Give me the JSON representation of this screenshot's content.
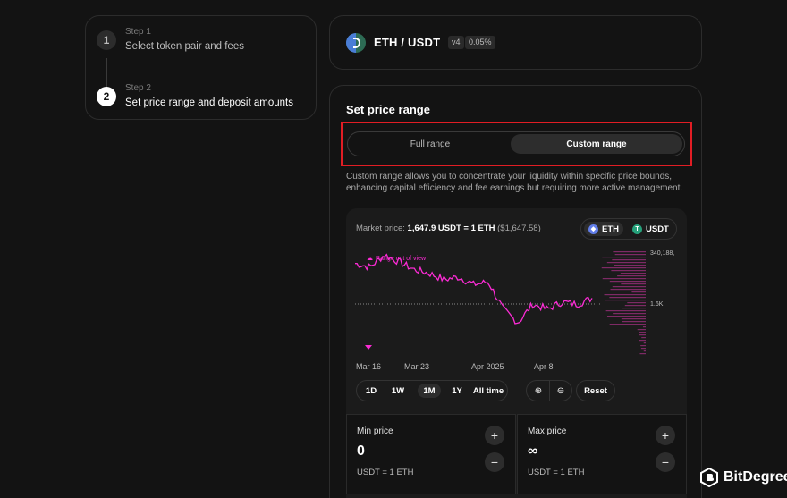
{
  "steps": [
    {
      "label": "Step 1",
      "title": "Select token pair and fees",
      "number": "1"
    },
    {
      "label": "Step 2",
      "title": "Set price range and deposit amounts",
      "number": "2"
    }
  ],
  "pair": {
    "title": "ETH / USDT",
    "version": "v4",
    "fee": "0.05%"
  },
  "range": {
    "title": "Set price range",
    "full_range": "Full range",
    "custom_range": "Custom range",
    "description": "Custom range allows you to concentrate your liquidity within specific price bounds, enhancing capital efficiency and fee earnings but requiring more active management."
  },
  "chart": {
    "market_label": "Market price:",
    "market_value": "1,647.9 USDT = 1 ETH",
    "market_usd": "($1,647.58)",
    "token_a": "ETH",
    "token_b": "USDT",
    "out_of_range": "Range out of view",
    "top_value": "340,188,",
    "mid_value": "1.6K",
    "x_labels": [
      "Mar 16",
      "Mar 23",
      "Apr 2025",
      "Apr 8"
    ],
    "line_color": "#fc2bd5"
  },
  "chart_data": {
    "type": "line",
    "x": [
      "Mar 16",
      "Mar 23",
      "Apr 2025",
      "Apr 8"
    ],
    "series": [
      {
        "values": [
          1930,
          1900,
          2000,
          1940,
          1880,
          1850,
          1800,
          1820,
          1760,
          1780,
          1560,
          1450,
          1600,
          1560,
          1620,
          1600,
          1650
        ]
      }
    ]
  },
  "time_buttons": [
    "1D",
    "1W",
    "1M",
    "1Y",
    "All time"
  ],
  "selected_time": "1M",
  "reset_label": "Reset",
  "min_price": {
    "label": "Min price",
    "value": "0",
    "unit": "USDT = 1 ETH"
  },
  "max_price": {
    "label": "Max price",
    "value": "∞",
    "unit": "USDT = 1 ETH"
  },
  "brand": "BitDegree"
}
